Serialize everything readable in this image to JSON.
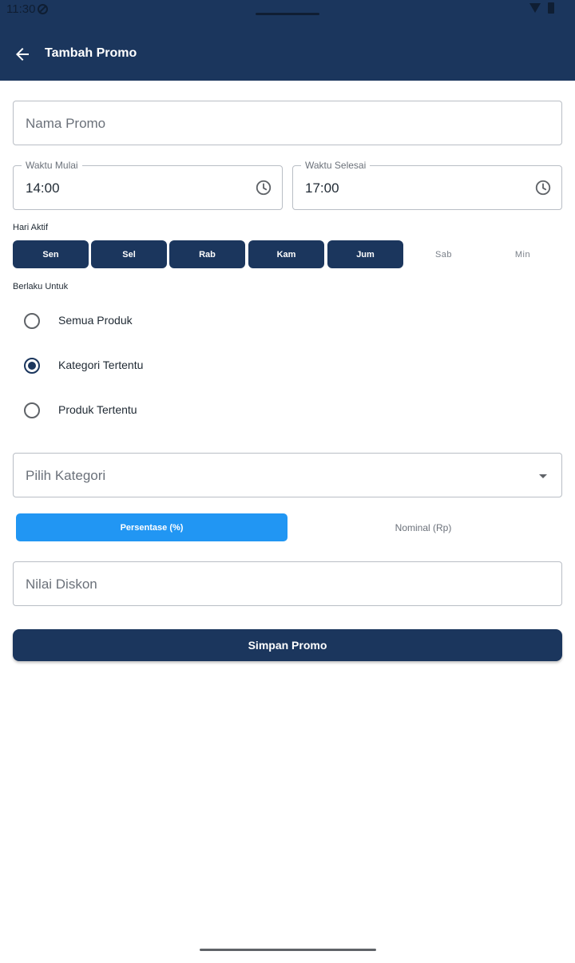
{
  "status": {
    "time": "11:30"
  },
  "appbar": {
    "title": "Tambah Promo"
  },
  "form": {
    "promo_name": {
      "placeholder": "Nama Promo",
      "value": ""
    },
    "start_time": {
      "label": "Waktu Mulai",
      "value": "14:00"
    },
    "end_time": {
      "label": "Waktu Selesai",
      "value": "17:00"
    },
    "active_days": {
      "label": "Hari Aktif",
      "days": [
        {
          "label": "Sen",
          "selected": true
        },
        {
          "label": "Sel",
          "selected": true
        },
        {
          "label": "Rab",
          "selected": true
        },
        {
          "label": "Kam",
          "selected": true
        },
        {
          "label": "Jum",
          "selected": true
        },
        {
          "label": "Sab",
          "selected": false
        },
        {
          "label": "Min",
          "selected": false
        }
      ]
    },
    "applies_to": {
      "label": "Berlaku Untuk",
      "options": [
        {
          "label": "Semua Produk",
          "checked": false
        },
        {
          "label": "Kategori Tertentu",
          "checked": true
        },
        {
          "label": "Produk Tertentu",
          "checked": false
        }
      ]
    },
    "category": {
      "placeholder": "Pilih Kategori"
    },
    "discount_type": {
      "options": [
        "Persentase (%)",
        "Nominal (Rp)"
      ],
      "selected": "Persentase (%)"
    },
    "discount_value": {
      "placeholder": "Nilai Diskon"
    },
    "save_label": "Simpan Promo"
  },
  "colors": {
    "primary": "#1b365d",
    "accent": "#2196f3"
  },
  "icons": {
    "back": "arrow-left-icon",
    "clock": "clock-icon",
    "dropdown": "caret-down-icon"
  }
}
